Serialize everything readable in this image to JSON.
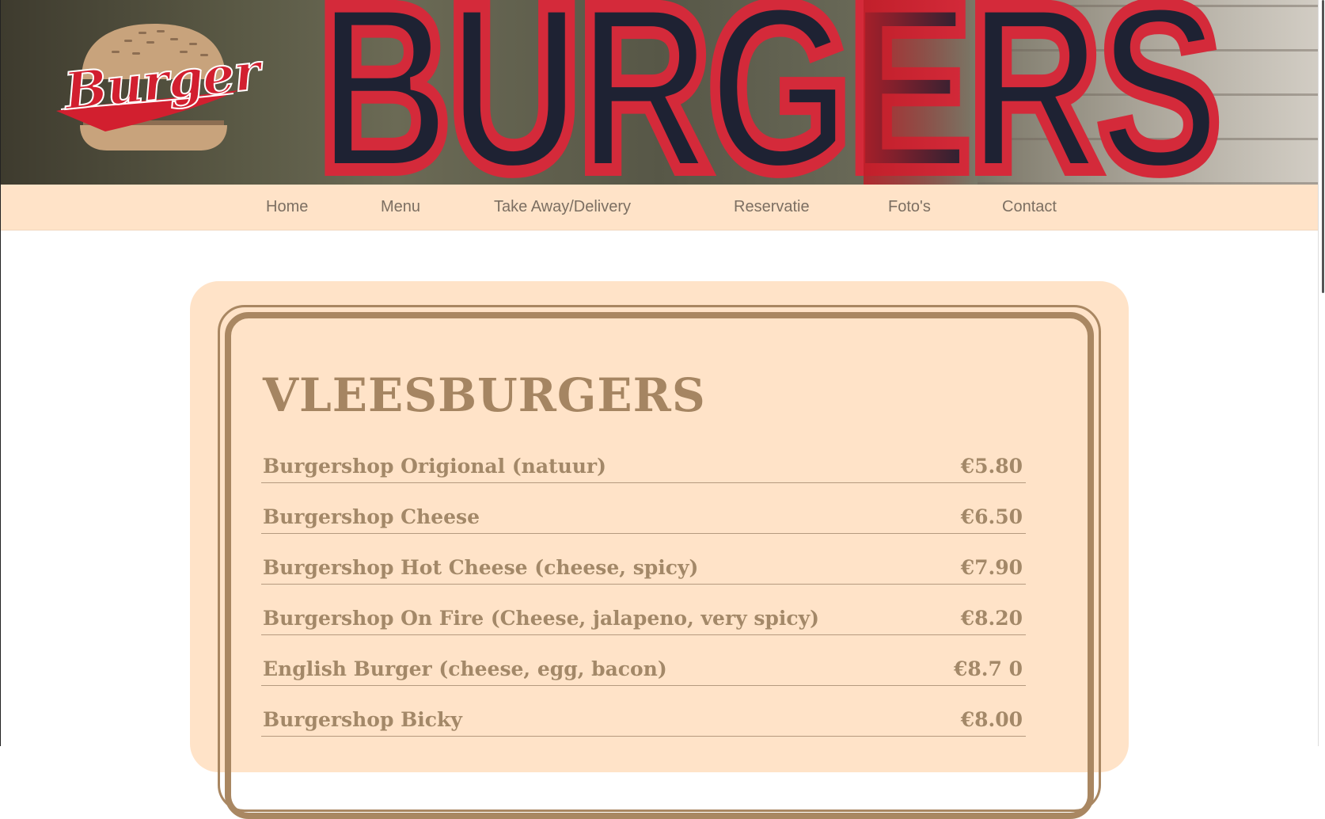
{
  "header": {
    "sign_text": "BURGERS",
    "logo_text": "Burger"
  },
  "nav": {
    "items": [
      {
        "label": "Home"
      },
      {
        "label": "Menu"
      },
      {
        "label": "Take Away/Delivery"
      },
      {
        "label": "Reservatie"
      },
      {
        "label": "Foto's"
      },
      {
        "label": "Contact"
      }
    ]
  },
  "menu": {
    "section_title": "VLEESBURGERS",
    "items": [
      {
        "name": "Burgershop Origional (natuur)",
        "price": "€5.80"
      },
      {
        "name": "Burgershop Cheese",
        "price": "€6.50"
      },
      {
        "name": "Burgershop Hot Cheese (cheese, spicy)",
        "price": "€7.90"
      },
      {
        "name": "Burgershop On Fire (Cheese, jalapeno, very spicy)",
        "price": "€8.20"
      },
      {
        "name": "English Burger (cheese, egg, bacon)",
        "price": "€8.7 0"
      },
      {
        "name": "Burgershop Bicky",
        "price": "€8.00"
      }
    ]
  },
  "colors": {
    "nav_bg": "#ffe3c8",
    "card_bg": "#ffe3c8",
    "accent_brown": "#a98762",
    "logo_red": "#d21f2f",
    "bun_tan": "#c8a37c"
  }
}
